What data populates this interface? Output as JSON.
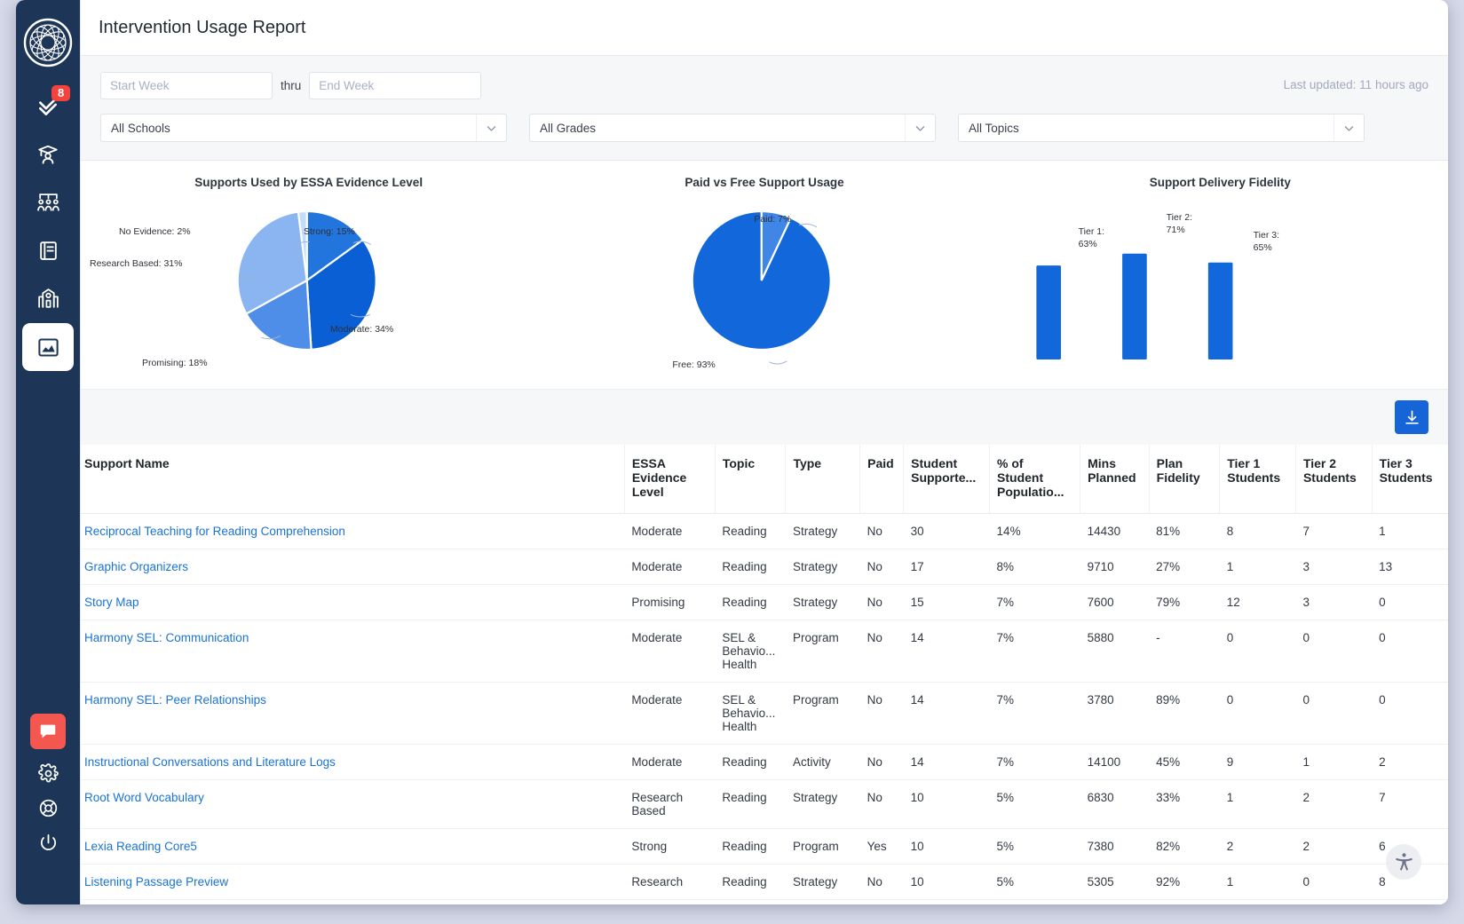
{
  "colors": {
    "sidebar_bg": "#1d3557",
    "accent_blue": "#1565d8",
    "link_blue": "#1a73d4",
    "chat_red": "#f4574f",
    "badge_red": "#f4433c"
  },
  "sidebar": {
    "logo_name": "app-logo",
    "badge_count": "8",
    "items": [
      {
        "icon": "double-check-icon",
        "label": "Tasks"
      },
      {
        "icon": "student-graduate-icon",
        "label": "Students"
      },
      {
        "icon": "group-people-icon",
        "label": "Groups"
      },
      {
        "icon": "book-icon",
        "label": "Curriculum"
      },
      {
        "icon": "school-building-icon",
        "label": "Schools"
      },
      {
        "icon": "chart-area-icon",
        "label": "Reports",
        "active": true
      }
    ],
    "bottom_items": [
      {
        "icon": "chat-bubble-icon",
        "label": "Messages"
      },
      {
        "icon": "gear-icon",
        "label": "Settings"
      },
      {
        "icon": "life-ring-icon",
        "label": "Help"
      },
      {
        "icon": "power-icon",
        "label": "Log out"
      }
    ]
  },
  "header": {
    "title": "Intervention Usage Report"
  },
  "filters": {
    "start_week_placeholder": "Start Week",
    "start_week_value": "",
    "thru_label": "thru",
    "end_week_placeholder": "End Week",
    "end_week_value": "",
    "last_updated": "Last updated: 11 hours ago",
    "schools_value": "All Schools",
    "grades_value": "All Grades",
    "topics_value": "All Topics"
  },
  "toolbar": {
    "download_label": "Download"
  },
  "chart_data": [
    {
      "type": "pie",
      "title": "Supports Used by ESSA Evidence Level",
      "labels": [
        "Strong",
        "Moderate",
        "Promising",
        "Research Based",
        "No Evidence"
      ],
      "values": [
        15,
        34,
        18,
        31,
        2
      ],
      "value_labels": [
        "Strong: 15%",
        "Moderate: 34%",
        "Promising: 18%",
        "Research Based: 31%",
        "No Evidence: 2%"
      ],
      "colors": [
        "#2175dd",
        "#0a5fd4",
        "#4f8ee8",
        "#8ab5f0",
        "#c3dcfa"
      ],
      "legend": "labeled-callouts"
    },
    {
      "type": "pie",
      "title": "Paid vs Free Support Usage",
      "labels": [
        "Paid",
        "Free"
      ],
      "values": [
        7,
        93
      ],
      "value_labels": [
        "Paid: 7%",
        "Free: 93%"
      ],
      "colors": [
        "#3f86e6",
        "#1268da"
      ],
      "legend": "labeled-callouts"
    },
    {
      "type": "bar",
      "title": "Support Delivery Fidelity",
      "categories": [
        "Tier 1",
        "Tier 2",
        "Tier 3"
      ],
      "values": [
        63,
        71,
        65
      ],
      "value_labels": [
        "Tier 1: 63%",
        "Tier 2: 71%",
        "Tier 3: 65%"
      ],
      "colors": [
        "#1268da",
        "#1268da",
        "#1268da"
      ],
      "ylim": [
        0,
        100
      ],
      "grid": false
    }
  ],
  "table": {
    "columns": [
      "Support Name",
      "ESSA Evidence Level",
      "Topic",
      "Type",
      "Paid",
      "Student Supporte...",
      "% of Student Populatio...",
      "Mins Planned",
      "Plan Fidelity",
      "Tier 1 Students",
      "Tier 2 Students",
      "Tier 3 Students"
    ],
    "rows": [
      {
        "name": "Reciprocal Teaching for Reading Comprehension",
        "essa": "Moderate",
        "topic": "Reading",
        "type": "Strategy",
        "paid": "No",
        "students": "30",
        "pct": "14%",
        "mins": "14430",
        "fidelity": "81%",
        "tier1": "8",
        "tier2": "7",
        "tier3": "1"
      },
      {
        "name": "Graphic Organizers",
        "essa": "Moderate",
        "topic": "Reading",
        "type": "Strategy",
        "paid": "No",
        "students": "17",
        "pct": "8%",
        "mins": "9710",
        "fidelity": "27%",
        "tier1": "1",
        "tier2": "3",
        "tier3": "13"
      },
      {
        "name": "Story Map",
        "essa": "Promising",
        "topic": "Reading",
        "type": "Strategy",
        "paid": "No",
        "students": "15",
        "pct": "7%",
        "mins": "7600",
        "fidelity": "79%",
        "tier1": "12",
        "tier2": "3",
        "tier3": "0"
      },
      {
        "name": "Harmony SEL: Communication",
        "essa": "Moderate",
        "topic": "SEL & Behavio... Health",
        "type": "Program",
        "paid": "No",
        "students": "14",
        "pct": "7%",
        "mins": "5880",
        "fidelity": "-",
        "tier1": "0",
        "tier2": "0",
        "tier3": "0"
      },
      {
        "name": "Harmony SEL: Peer Relationships",
        "essa": "Moderate",
        "topic": "SEL & Behavio... Health",
        "type": "Program",
        "paid": "No",
        "students": "14",
        "pct": "7%",
        "mins": "3780",
        "fidelity": "89%",
        "tier1": "0",
        "tier2": "0",
        "tier3": "0"
      },
      {
        "name": "Instructional Conversations and Literature Logs",
        "essa": "Moderate",
        "topic": "Reading",
        "type": "Activity",
        "paid": "No",
        "students": "14",
        "pct": "7%",
        "mins": "14100",
        "fidelity": "45%",
        "tier1": "9",
        "tier2": "1",
        "tier3": "2"
      },
      {
        "name": "Root Word Vocabulary",
        "essa": "Research Based",
        "topic": "Reading",
        "type": "Strategy",
        "paid": "No",
        "students": "10",
        "pct": "5%",
        "mins": "6830",
        "fidelity": "33%",
        "tier1": "1",
        "tier2": "2",
        "tier3": "7"
      },
      {
        "name": "Lexia Reading Core5",
        "essa": "Strong",
        "topic": "Reading",
        "type": "Program",
        "paid": "Yes",
        "students": "10",
        "pct": "5%",
        "mins": "7380",
        "fidelity": "82%",
        "tier1": "2",
        "tier2": "2",
        "tier3": "6"
      },
      {
        "name": "Listening Passage Preview",
        "essa": "Research",
        "topic": "Reading",
        "type": "Strategy",
        "paid": "No",
        "students": "10",
        "pct": "5%",
        "mins": "5305",
        "fidelity": "92%",
        "tier1": "1",
        "tier2": "0",
        "tier3": "8"
      }
    ]
  },
  "accessibility_widget": {
    "icon": "accessibility-icon"
  }
}
